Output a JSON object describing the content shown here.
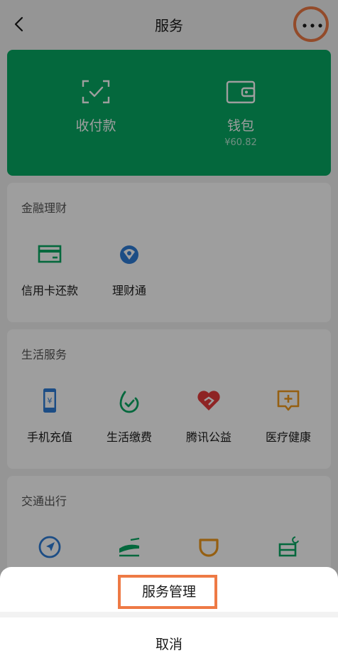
{
  "header": {
    "title": "服务"
  },
  "wallet": {
    "pay_label": "收付款",
    "wallet_label": "钱包",
    "balance": "¥60.82"
  },
  "sections": [
    {
      "title": "金融理财",
      "items": [
        {
          "label": "信用卡还款",
          "icon": "credit-card-icon"
        },
        {
          "label": "理财通",
          "icon": "wealth-icon"
        }
      ]
    },
    {
      "title": "生活服务",
      "items": [
        {
          "label": "手机充值",
          "icon": "phone-topup-icon"
        },
        {
          "label": "生活缴费",
          "icon": "utility-bill-icon"
        },
        {
          "label": "腾讯公益",
          "icon": "charity-heart-icon"
        },
        {
          "label": "医疗健康",
          "icon": "medical-icon"
        }
      ]
    },
    {
      "title": "交通出行",
      "items": [
        {
          "label": "",
          "icon": "navigation-icon"
        },
        {
          "label": "",
          "icon": "train-icon"
        },
        {
          "label": "",
          "icon": "didi-icon"
        },
        {
          "label": "",
          "icon": "hotel-bed-icon"
        }
      ]
    }
  ],
  "sheet": {
    "manage_label": "服务管理",
    "cancel_label": "取消"
  },
  "colors": {
    "accent": "#07a863",
    "highlight": "#ee7a45"
  }
}
